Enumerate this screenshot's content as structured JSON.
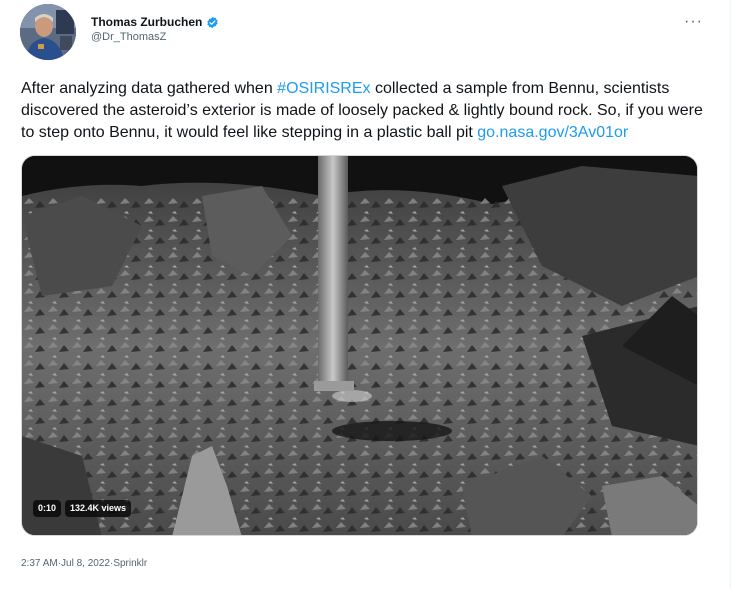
{
  "author": {
    "display_name": "Thomas Zurbuchen",
    "handle": "@Dr_ThomasZ",
    "verified_color": "#1d9bf0"
  },
  "tweet": {
    "text_before": "After analyzing data gathered when ",
    "hashtag": "#OSIRISREx",
    "text_middle": " collected a sample from Bennu, scientists discovered the asteroid’s exterior is made of loosely packed & lightly bound rock. So, if you were to step onto Bennu, it would feel like stepping in a plastic ball pit ",
    "link": "go.nasa.gov/3Av01or"
  },
  "media": {
    "duration": "0:10",
    "views": "132.4K views"
  },
  "meta": {
    "time": "2:37 AM",
    "separator": " · ",
    "date": "Jul 8, 2022",
    "source": "Sprinklr"
  },
  "icons": {
    "more": "more-horizontal-icon",
    "verified": "verified-badge-icon"
  },
  "colors": {
    "link": "#1d9bf0",
    "text": "#0f1419",
    "secondary": "#536471"
  }
}
